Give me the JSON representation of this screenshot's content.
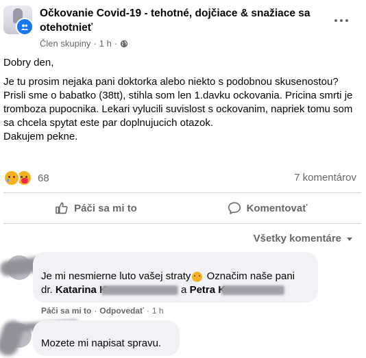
{
  "post": {
    "group_name": "Očkovanie Covid-19 - tehotné, dojčiace & snažiace sa otehotnieť",
    "author_role": "Člen skupiny",
    "separator": "·",
    "time": "1 h",
    "privacy_icon": "globe-icon",
    "body": {
      "greeting": "Dobry den,",
      "paragraph": "Je tu prosim nejaka pani doktorka alebo niekto s podobnou skusenostou? Prisli sme o babatko (38tt), stihla som len 1.davku ockovania. Pricina smrti je tromboza pupocnika. Lekari vylucili suvislost s ockovanim, napriek tomu som sa chcela spytat este par doplnujucich otazok.",
      "closing": "Dakujem pekne."
    },
    "reaction_icons": [
      "sad-reaction-icon",
      "care-reaction-icon"
    ],
    "reaction_count": "68",
    "comment_count": "7 komentárov"
  },
  "actions": {
    "like_label": "Páči sa mi to",
    "comment_label": "Komentovať"
  },
  "comments_section": {
    "sort_label": "Všetky komentáre"
  },
  "comments": [
    {
      "line1_prefix": "Je mi nesmierne luto vašej straty",
      "line1_suffix": " Označim naše pani",
      "line2_prefix": "dr. ",
      "mention1": "Katarina K",
      "line2_mid": " a ",
      "mention2": "Petra K",
      "like_label": "Páči sa mi to",
      "reply_label": "Odpovedať",
      "time": "1 h"
    },
    {
      "text": "Mozete mi napisat spravu."
    }
  ],
  "colors": {
    "accent": "#1877f2",
    "secondary_text": "#65676b",
    "bubble": "#f0f2f5"
  }
}
